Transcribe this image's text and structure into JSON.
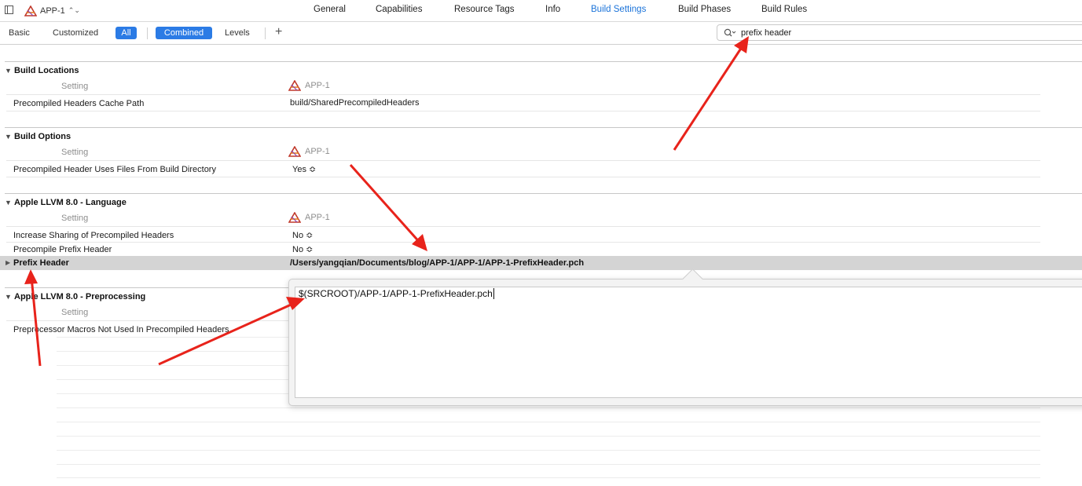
{
  "window": {
    "target_name": "APP-1"
  },
  "tabs": [
    {
      "label": "General"
    },
    {
      "label": "Capabilities"
    },
    {
      "label": "Resource Tags"
    },
    {
      "label": "Info"
    },
    {
      "label": "Build Settings",
      "active": true
    },
    {
      "label": "Build Phases"
    },
    {
      "label": "Build Rules"
    }
  ],
  "filter": {
    "basic": "Basic",
    "customized": "Customized",
    "all": "All",
    "combined": "Combined",
    "levels": "Levels",
    "search_value": "prefix header"
  },
  "sections": [
    {
      "title": "Build Locations",
      "column_setting": "Setting",
      "column_target": "APP-1",
      "rows": [
        {
          "label": "Precompiled Headers Cache Path",
          "value": "build/SharedPrecompiledHeaders"
        }
      ]
    },
    {
      "title": "Build Options",
      "column_setting": "Setting",
      "column_target": "APP-1",
      "rows": [
        {
          "label": "Precompiled Header Uses Files From Build Directory",
          "value": "Yes ≎"
        }
      ]
    },
    {
      "title": "Apple LLVM 8.0 - Language",
      "column_setting": "Setting",
      "column_target": "APP-1",
      "rows": [
        {
          "label": "Increase Sharing of Precompiled Headers",
          "value": "No ≎"
        },
        {
          "label": "Precompile Prefix Header",
          "value": "No ≎"
        },
        {
          "label": "Prefix Header",
          "value": "/Users/yangqian/Documents/blog/APP-1/APP-1/APP-1-PrefixHeader.pch"
        }
      ]
    },
    {
      "title": "Apple LLVM 8.0 - Preprocessing",
      "column_setting": "Setting",
      "rows": [
        {
          "label": "Preprocessor Macros Not Used In Precompiled Headers"
        }
      ]
    }
  ],
  "popover": {
    "edit_value": "$(SRCROOT)/APP-1/APP-1-PrefixHeader.pch"
  },
  "colors": {
    "accent": "#2b7be5",
    "annotation_arrow": "#e8231b",
    "selected_row": "#d4d4d4"
  }
}
